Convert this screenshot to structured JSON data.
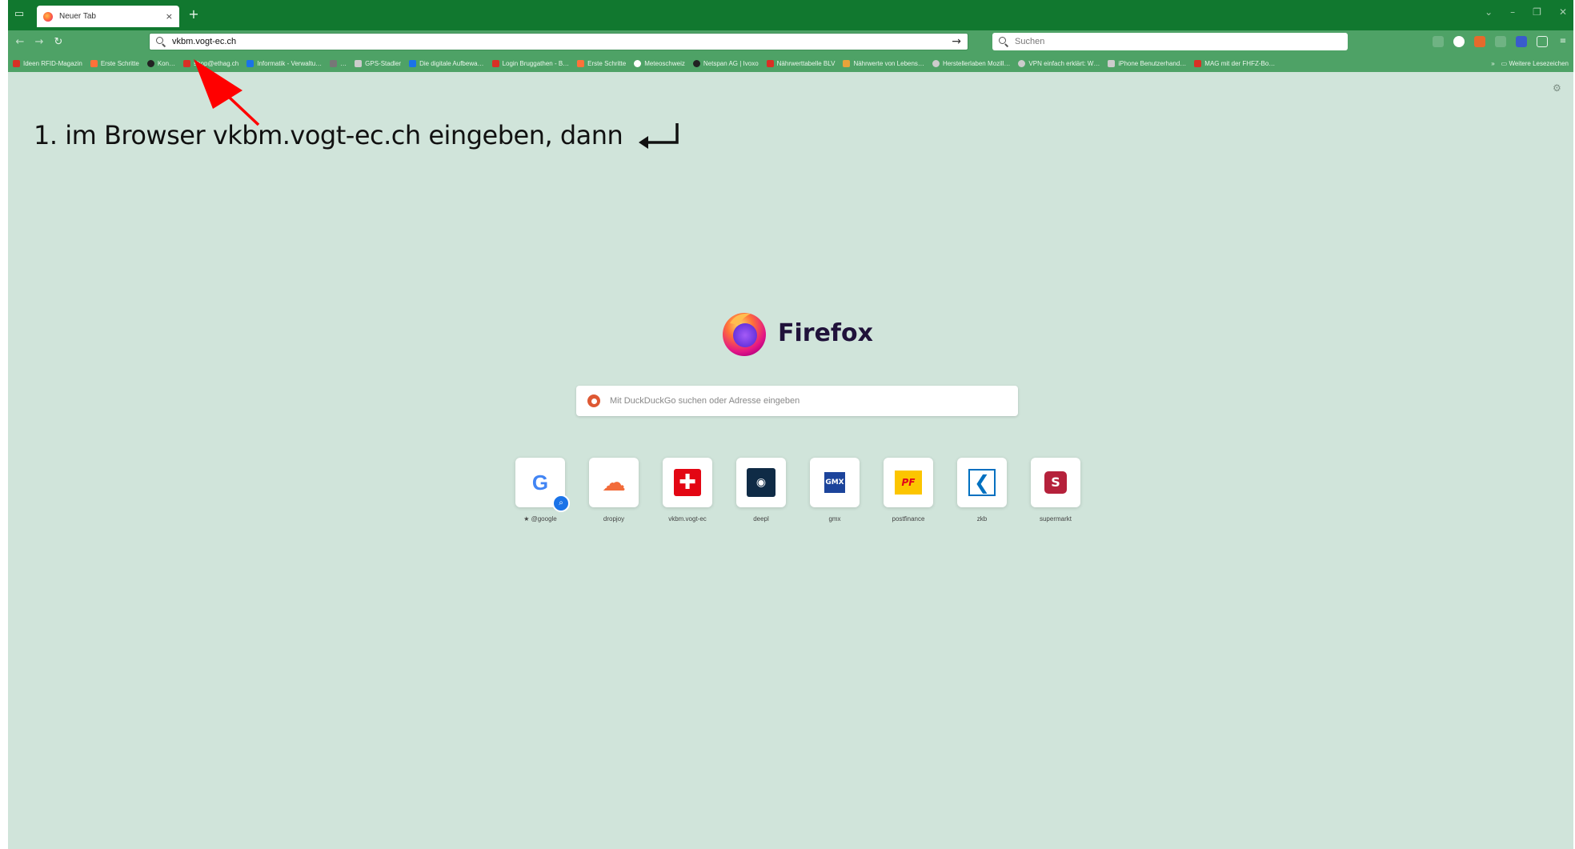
{
  "browser": {
    "tab": {
      "title": "Neuer Tab",
      "close": "×"
    },
    "new_tab": "+",
    "window_controls": [
      "⌄",
      "–",
      "❐",
      "✕"
    ],
    "nav": {
      "back": "←",
      "forward": "→",
      "reload": "↻"
    },
    "url_value": "vkbm.vogt-ec.ch",
    "url_go": "→",
    "search_placeholder": "Suchen"
  },
  "bookmarks": {
    "items": [
      {
        "label": "Ideen RFID-Magazin",
        "color": "#d93025"
      },
      {
        "label": "Erste Schritte",
        "color": "#ff7139"
      },
      {
        "label": "Kon…",
        "color": "#222222"
      },
      {
        "label": "shop@ethag.ch",
        "color": "#d93025"
      },
      {
        "label": "Informatik - Verwaltu…",
        "color": "#1a73e8"
      },
      {
        "label": "…",
        "color": "#777777"
      },
      {
        "label": "GPS-Stadler",
        "color": "#cccccc"
      },
      {
        "label": "Die digitale Aufbewa…",
        "color": "#1a73e8"
      },
      {
        "label": "Login Bruggathen - B…",
        "color": "#d93025"
      },
      {
        "label": "Erste Schritte",
        "color": "#ff7139"
      },
      {
        "label": "Meteoschweiz",
        "color": "#ffffff"
      },
      {
        "label": "Netspan AG | Ivoxo",
        "color": "#222222"
      },
      {
        "label": "Nährwerttabelle BLV",
        "color": "#d93025"
      },
      {
        "label": "Nährwerte von Lebens…",
        "color": "#e8a33a"
      },
      {
        "label": "Herstellerlaben Mozill…",
        "color": "#cccccc"
      },
      {
        "label": "VPN einfach erklärt: W…",
        "color": "#cccccc"
      },
      {
        "label": "iPhone Benutzerhand…",
        "color": "#cccccc"
      },
      {
        "label": "MAG mit der FHFZ-Bo…",
        "color": "#d93025"
      }
    ],
    "more": "»",
    "other_label": "Weitere Lesezeichen"
  },
  "annotation": {
    "instruction": "1. im Browser vkbm.vogt-ec.ch eingeben, dann"
  },
  "newtab": {
    "brand": "Firefox",
    "search_placeholder": "Mit DuckDuckGo suchen oder Adresse eingeben",
    "shortcuts": [
      {
        "label": "★ @google",
        "glyph": "G",
        "color": "#4285f4"
      },
      {
        "label": "dropjoy",
        "glyph": "☁",
        "color": "#f26b3a"
      },
      {
        "label": "vkbm.vogt-ec",
        "glyph": "✚",
        "color": "#e30613"
      },
      {
        "label": "deepl",
        "glyph": "◉",
        "color": "#0f2b46"
      },
      {
        "label": "gmx",
        "glyph": "GMX",
        "color": "#1c449b"
      },
      {
        "label": "postfinance",
        "glyph": "PF",
        "color": "#fcc500"
      },
      {
        "label": "zkb",
        "glyph": "❮",
        "color": "#0070c0"
      },
      {
        "label": "supermarkt",
        "glyph": "S",
        "color": "#b5213b"
      }
    ]
  },
  "colors": {
    "tabstrip": "#11782f",
    "toolbar": "#4ea266",
    "page_background": "#d0e4da",
    "annotation_arrow": "#ff0000"
  }
}
